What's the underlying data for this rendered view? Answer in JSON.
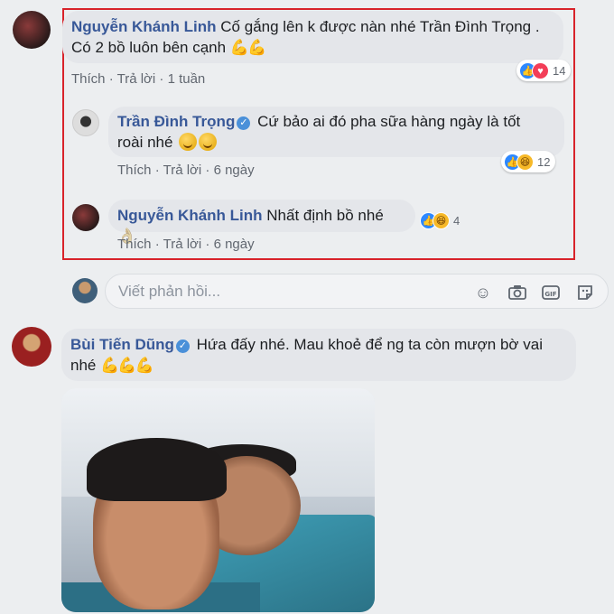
{
  "comments": [
    {
      "author": "Nguyễn Khánh Linh",
      "text_line1": "Cố gắng lên k được nàn nhé Trần Đình Trọng .",
      "text_line2": "Có 2 bồ luôn bên cạnh",
      "emoji": "💪💪",
      "like": "Thích",
      "reply": "Trả lời",
      "time": "1 tuần",
      "reaction_count": "14"
    }
  ],
  "replies": [
    {
      "author": "Trần Đình Trọng",
      "text_line1": "Cứ bảo ai đó pha sữa hàng ngày là tốt",
      "text_line2": "roài nhé",
      "like": "Thích",
      "reply": "Trả lời",
      "time": "6 ngày",
      "reaction_count": "12"
    },
    {
      "author": "Nguyễn Khánh Linh",
      "text": "Nhất định bồ nhé",
      "emoji": "👌",
      "like": "Thích",
      "reply": "Trả lời",
      "time": "6 ngày",
      "reaction_count": "4"
    }
  ],
  "reply_box": {
    "placeholder": "Viết phản hồi..."
  },
  "second_comment": {
    "author": "Bùi Tiến Dũng",
    "text_line1": "Hứa đấy nhé. Mau khoẻ để ng ta còn mượn bờ vai",
    "text_line2": "nhé",
    "emoji": "💪💪💪"
  },
  "separator": "·",
  "colors": {
    "link": "#385898",
    "highlight_border": "#d8232a",
    "bubble": "#e4e6ea"
  }
}
